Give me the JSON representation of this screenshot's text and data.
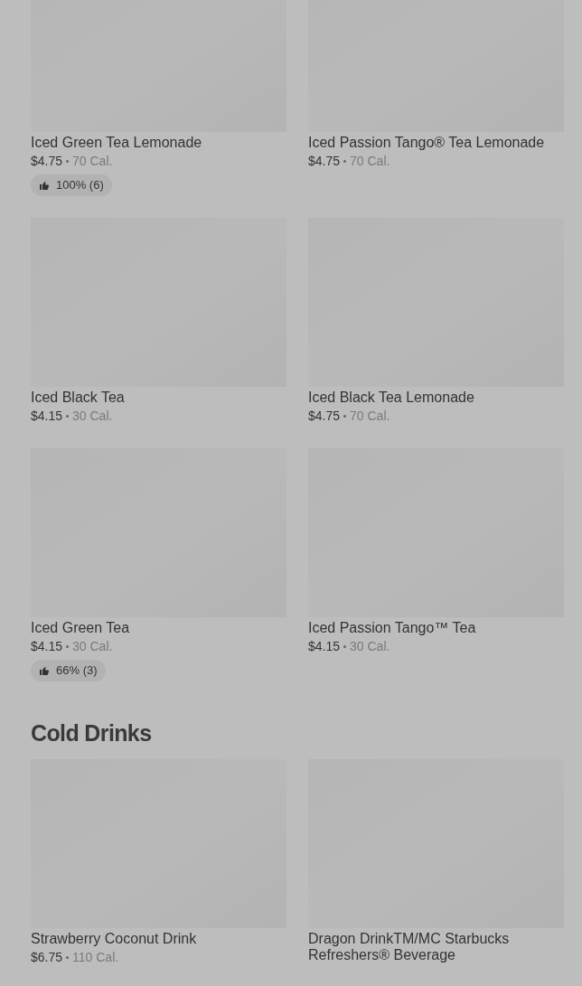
{
  "sections": [
    {
      "items": [
        {
          "name": "Iced Green Tea Lemonade",
          "price": "$4.75",
          "calories": "70 Cal.",
          "rating": "100% (6)"
        },
        {
          "name": "Iced Passion Tango® Tea Lemonade",
          "price": "$4.75",
          "calories": "70 Cal."
        },
        {
          "name": "Iced Black Tea",
          "price": "$4.15",
          "calories": "30 Cal."
        },
        {
          "name": "Iced Black Tea Lemonade",
          "price": "$4.75",
          "calories": "70 Cal."
        },
        {
          "name": "Iced Green Tea",
          "price": "$4.15",
          "calories": "30 Cal.",
          "rating": "66% (3)"
        },
        {
          "name": "Iced Passion Tango™ Tea",
          "price": "$4.15",
          "calories": "30 Cal."
        }
      ]
    },
    {
      "title": "Cold Drinks",
      "items": [
        {
          "name": "Strawberry Coconut Drink",
          "price": "$6.75",
          "calories": "110 Cal."
        },
        {
          "name": "Dragon DrinkTM/MC Starbucks Refreshers® Beverage"
        }
      ]
    }
  ]
}
